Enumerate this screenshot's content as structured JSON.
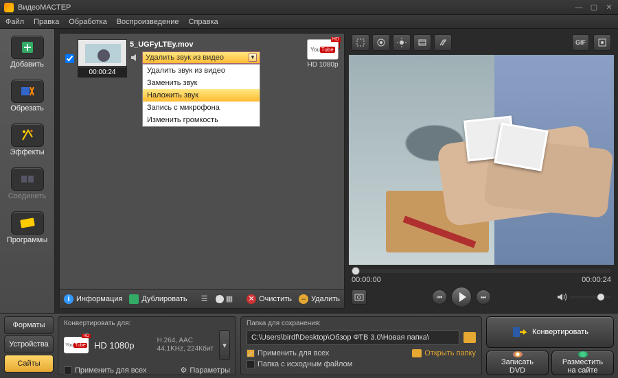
{
  "app": {
    "title": "ВидеоМАСТЕР"
  },
  "menu": [
    "Файл",
    "Правка",
    "Обработка",
    "Воспроизведение",
    "Справка"
  ],
  "sidebar": [
    {
      "label": "Добавить"
    },
    {
      "label": "Обрезать"
    },
    {
      "label": "Эффекты"
    },
    {
      "label": "Соединить"
    },
    {
      "label": "Программы"
    }
  ],
  "file": {
    "name": "5_UGFyLTEy.mov",
    "duration": "00:00:24",
    "output_label": "HD 1080p"
  },
  "audio_menu": {
    "selected": "Удалить звук из видео",
    "items": [
      "Удалить звук из видео",
      "Заменить звук",
      "Наложить звук",
      "Запись с микрофона",
      "Изменить громкость"
    ]
  },
  "list_toolbar": {
    "info": "Информация",
    "duplicate": "Дублировать",
    "clear": "Очистить",
    "delete": "Удалить"
  },
  "preview": {
    "time_start": "00:00:00",
    "time_end": "00:00:24",
    "gif": "GIF"
  },
  "bottom_tabs": [
    "Форматы",
    "Устройства",
    "Сайты"
  ],
  "convert": {
    "panel_label": "Конвертировать для:",
    "preset": "HD 1080p",
    "codec1": "H.264, AAC",
    "codec2": "44,1KHz, 224Кбит",
    "apply_all": "Применить для всех",
    "params": "Параметры"
  },
  "save": {
    "panel_label": "Папка для сохранения:",
    "path": "C:\\Users\\birdf\\Desktop\\Обзор ФТВ 3.0\\Новая папка\\",
    "apply_all": "Применить для всех",
    "keep_source": "Папка с исходным файлом",
    "open_folder": "Открыть папку"
  },
  "actions": {
    "convert": "Конвертировать",
    "burn1": "Записать",
    "burn2": "DVD",
    "upload1": "Разместить",
    "upload2": "на сайте"
  }
}
